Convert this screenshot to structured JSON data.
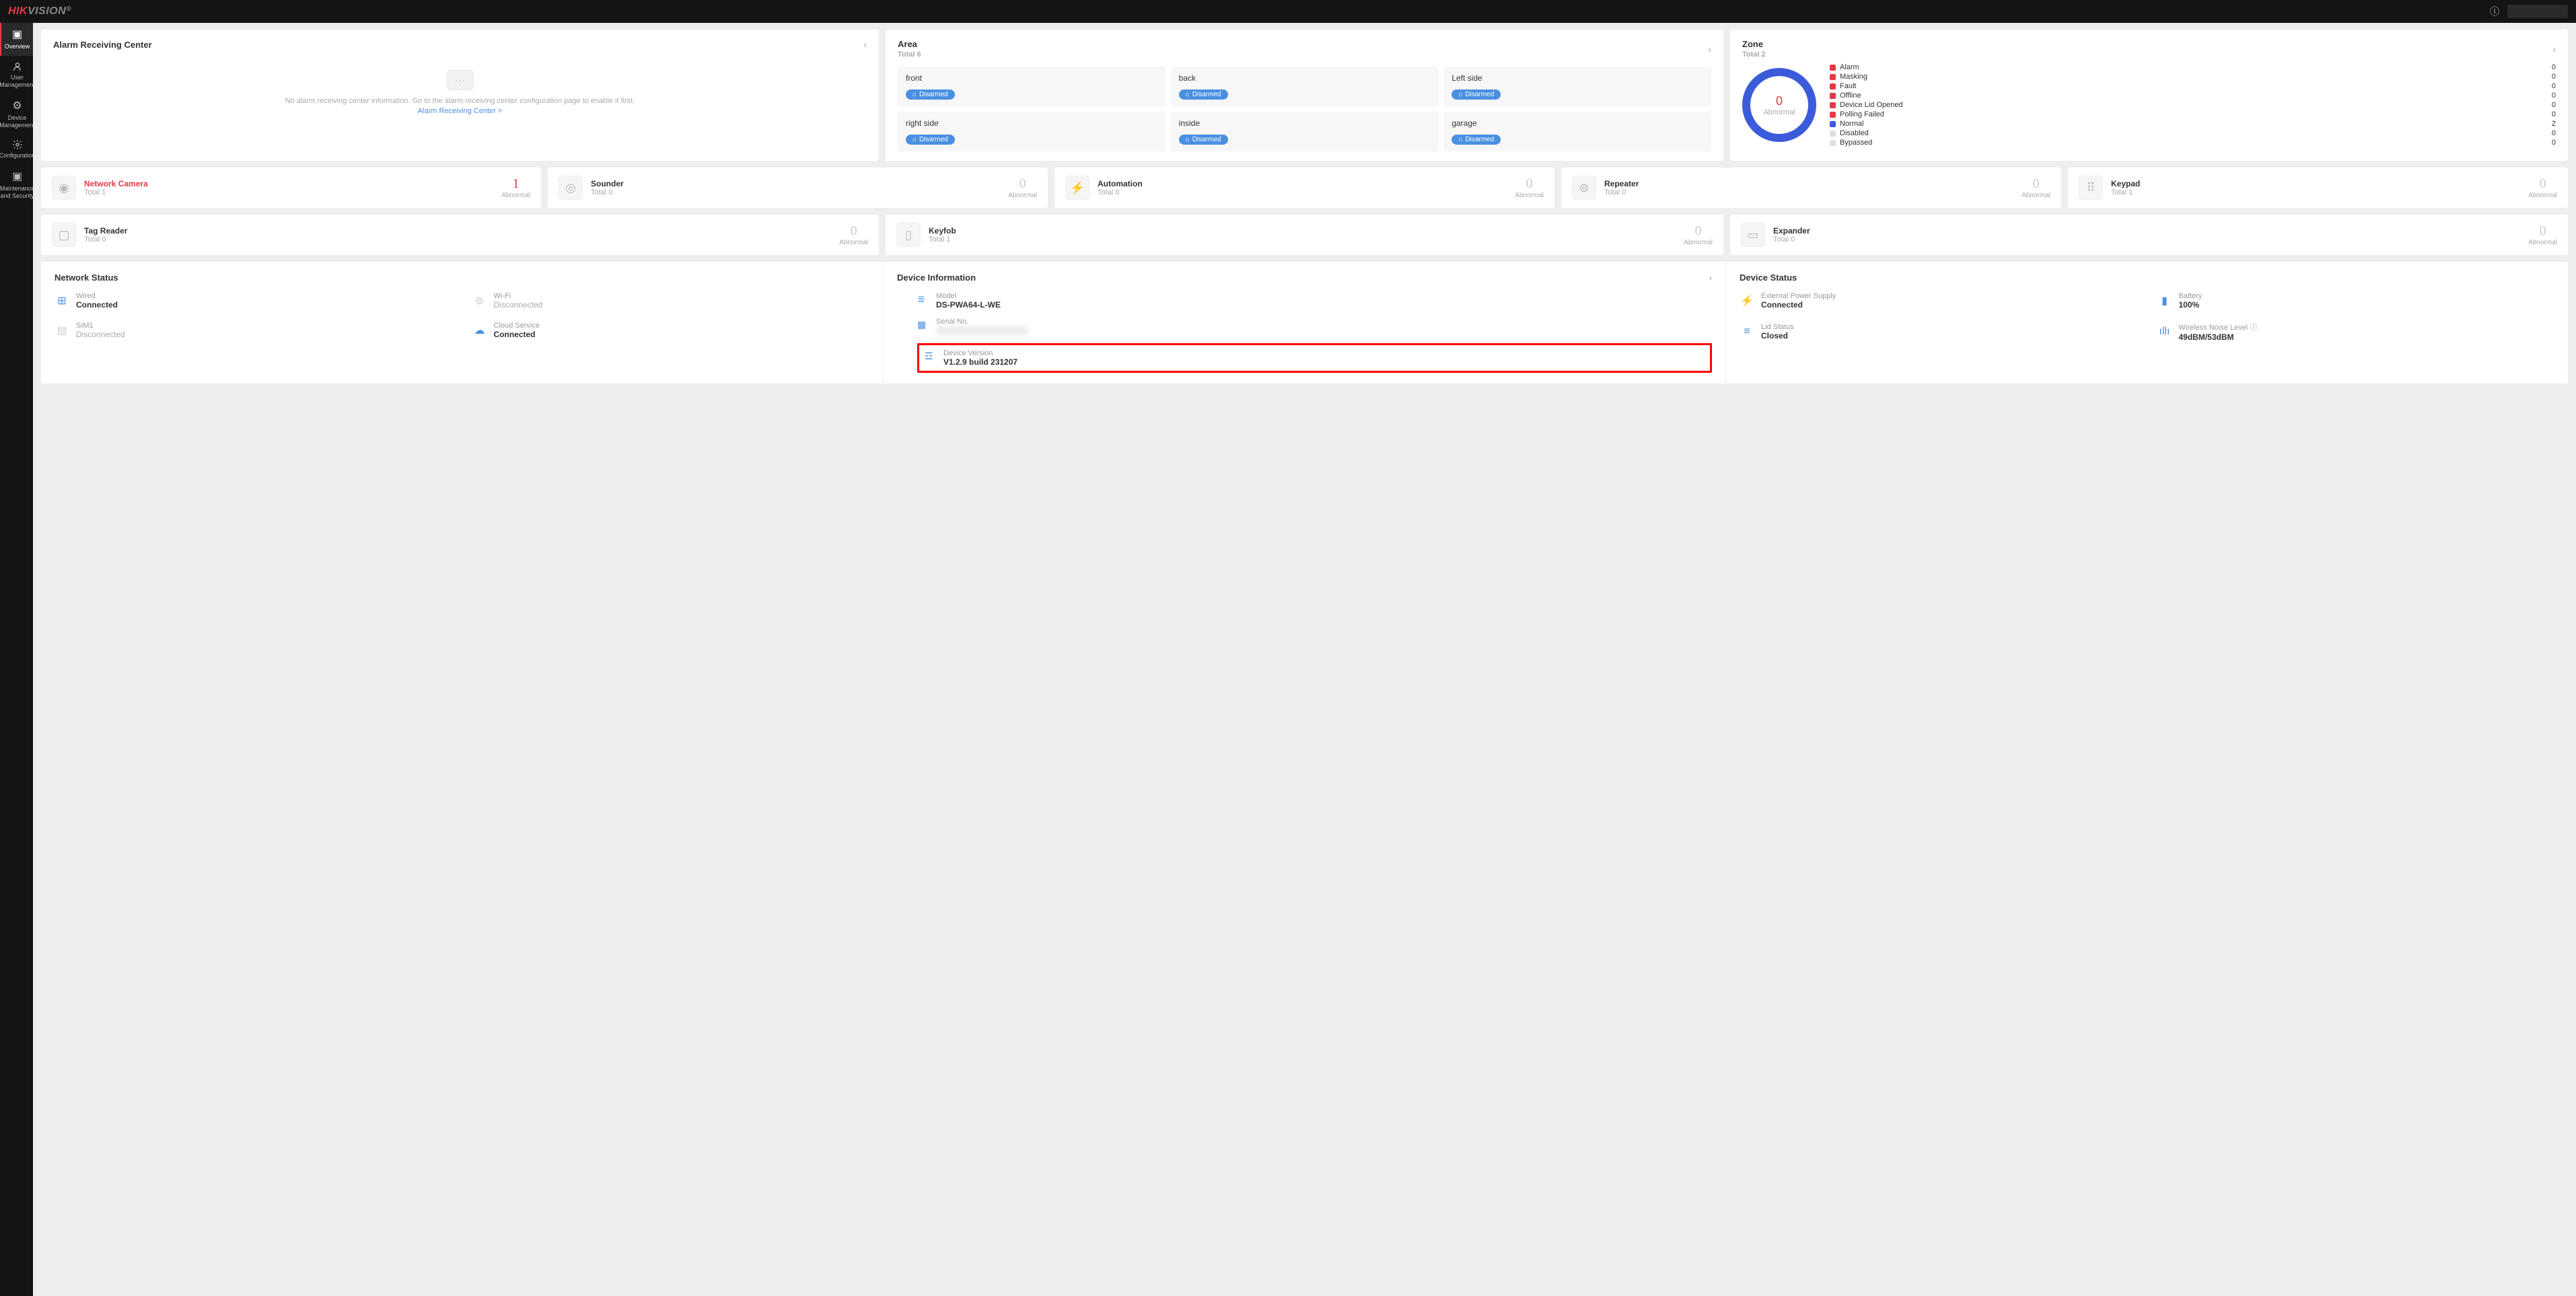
{
  "brand": {
    "prefix": "HIK",
    "suffix": "VISION",
    "trademark": "®"
  },
  "sidebar": {
    "items": [
      {
        "label": "Overview"
      },
      {
        "label": "User Management"
      },
      {
        "label": "Device Management"
      },
      {
        "label": "Configuration"
      },
      {
        "label": "Maintenance and Security"
      }
    ]
  },
  "arc": {
    "title": "Alarm Receiving Center",
    "empty_text": "No alarm receiving center information. Go to the alarm receiving center configuration page to enable it first.",
    "link_text": "Alarm Receiving Center >"
  },
  "area": {
    "title": "Area",
    "subtitle": "Total 6",
    "items": [
      {
        "name": "front",
        "status": "Disarmed"
      },
      {
        "name": "back",
        "status": "Disarmed"
      },
      {
        "name": "Left side",
        "status": "Disarmed"
      },
      {
        "name": "right side",
        "status": "Disarmed"
      },
      {
        "name": "inside",
        "status": "Disarmed"
      },
      {
        "name": "garage",
        "status": "Disarmed"
      }
    ]
  },
  "zone": {
    "title": "Zone",
    "subtitle": "Total 2",
    "donut_value": "0",
    "donut_label": "Abnormal",
    "rows": [
      {
        "label": "Alarm",
        "count": "0",
        "color": "red"
      },
      {
        "label": "Masking",
        "count": "0",
        "color": "red"
      },
      {
        "label": "Fault",
        "count": "0",
        "color": "red"
      },
      {
        "label": "Offline",
        "count": "0",
        "color": "red"
      },
      {
        "label": "Device Lid Opened",
        "count": "0",
        "color": "red"
      },
      {
        "label": "Polling Failed",
        "count": "0",
        "color": "red"
      },
      {
        "label": "Normal",
        "count": "2",
        "color": "blue"
      },
      {
        "label": "Disabled",
        "count": "0",
        "color": "gray"
      },
      {
        "label": "Bypassed",
        "count": "0",
        "color": "gray"
      }
    ]
  },
  "devices_row1": [
    {
      "name": "Network Camera",
      "total": "Total 1",
      "count": "1",
      "abnormal": "Abnormal",
      "alert": true,
      "glyph": "◉"
    },
    {
      "name": "Sounder",
      "total": "Total 0",
      "count": "0",
      "abnormal": "Abnormal",
      "alert": false,
      "glyph": "◎"
    },
    {
      "name": "Automation",
      "total": "Total 0",
      "count": "0",
      "abnormal": "Abnormal",
      "alert": false,
      "glyph": "⚡"
    },
    {
      "name": "Repeater",
      "total": "Total 0",
      "count": "0",
      "abnormal": "Abnormal",
      "alert": false,
      "glyph": "⊚"
    },
    {
      "name": "Keypad",
      "total": "Total 1",
      "count": "0",
      "abnormal": "Abnormal",
      "alert": false,
      "glyph": "⠿"
    }
  ],
  "devices_row2": [
    {
      "name": "Tag Reader",
      "total": "Total 0",
      "count": "0",
      "abnormal": "Abnormal",
      "alert": false,
      "glyph": "▢"
    },
    {
      "name": "Keyfob",
      "total": "Total 1",
      "count": "0",
      "abnormal": "Abnormal",
      "alert": false,
      "glyph": "▯"
    },
    {
      "name": "Expander",
      "total": "Total 0",
      "count": "0",
      "abnormal": "Abnormal",
      "alert": false,
      "glyph": "▭"
    }
  ],
  "network_status": {
    "title": "Network Status",
    "items": [
      {
        "label": "Wired",
        "value": "Connected",
        "connected": true,
        "glyph": "⊞"
      },
      {
        "label": "Wi-Fi",
        "value": "Disconnected",
        "connected": false,
        "glyph": "⊚"
      },
      {
        "label": "SIM1",
        "value": "Disconnected",
        "connected": false,
        "glyph": "▤"
      },
      {
        "label": "Cloud Service",
        "value": "Connected",
        "connected": true,
        "glyph": "☁"
      }
    ]
  },
  "device_info": {
    "title": "Device Information",
    "items": [
      {
        "label": "Model",
        "value": "DS-PWA64-L-WE",
        "glyph": "≣",
        "blurred": false
      },
      {
        "label": "Serial No.",
        "value": "████████████████",
        "glyph": "▦",
        "blurred": true
      },
      {
        "label": "Device Version",
        "value": "V1.2.9 build 231207",
        "glyph": "☲",
        "blurred": false,
        "highlight": true
      }
    ]
  },
  "device_status": {
    "title": "Device Status",
    "items": [
      {
        "label": "External Power Supply",
        "value": "Connected",
        "glyph": "⚡"
      },
      {
        "label": "Battery",
        "value": "100%",
        "glyph": "▮"
      },
      {
        "label": "Lid Status",
        "value": "Closed",
        "glyph": "≡"
      },
      {
        "label": "Wireless Noise Level ⓘ",
        "value": "49dBM/53dBM",
        "glyph": "ıllı"
      }
    ]
  }
}
